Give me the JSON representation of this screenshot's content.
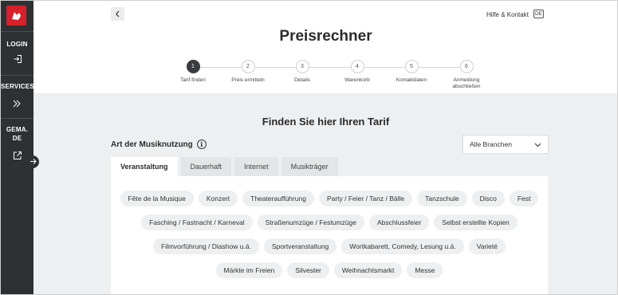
{
  "sidebar": {
    "login_label": "LOGIN",
    "services_label": "SERVICES",
    "gema_label_line1": "GEMA.",
    "gema_label_line2": "DE"
  },
  "header": {
    "help_label": "Hilfe & Kontakt",
    "lang_label": "DE",
    "title": "Preisrechner"
  },
  "stepper": {
    "steps": [
      {
        "number": "1",
        "label": "Tarif finden",
        "active": true
      },
      {
        "number": "2",
        "label": "Preis ermitteln"
      },
      {
        "number": "3",
        "label": "Details"
      },
      {
        "number": "4",
        "label": "Warenkorb"
      },
      {
        "number": "5",
        "label": "Kontaktdaten"
      },
      {
        "number": "6",
        "label_line1": "Anmeldung",
        "label_line2": "abschließen"
      }
    ]
  },
  "main": {
    "section_title": "Finden Sie hier Ihren Tarif",
    "usage_label": "Art der Musiknutzung",
    "info_icon": "i",
    "dropdown_value": "Alle Branchen",
    "tabs": [
      "Veranstaltung",
      "Dauerhaft",
      "Internet",
      "Musikträger"
    ],
    "chips": [
      [
        "Fête de la Musique",
        "Konzert",
        "Theateraufführung",
        "Party / Feier / Tanz / Bälle",
        "Tanzschule",
        "Disco",
        "Fest"
      ],
      [
        "Fasching / Fastnacht / Karneval",
        "Straßenumzüge / Festumzüge",
        "Abschlussfeier",
        "Selbst erstellte Kopien"
      ],
      [
        "Filmvorführung / Diashow u.ä.",
        "Sportveranstaltung",
        "Wortkabarett, Comedy, Lesung u.ä.",
        "Varieté"
      ],
      [
        "Märkte im Freien",
        "Silvester",
        "Weihnachtsmarkt",
        "Messe"
      ]
    ]
  },
  "colors": {
    "sidebar_bg": "#2e3034",
    "logo_red": "#d6202a",
    "main_bg": "#eeeff0",
    "active_step": "#3a3c40"
  },
  "icons": {
    "logo": "gema-logo-icon",
    "login": "login-icon",
    "services": "services-chevrons-icon",
    "external": "external-link-icon",
    "collapse": "arrow-right-icon",
    "back": "chevron-left-icon",
    "dropdown": "chevron-down-icon",
    "info": "info-icon"
  }
}
